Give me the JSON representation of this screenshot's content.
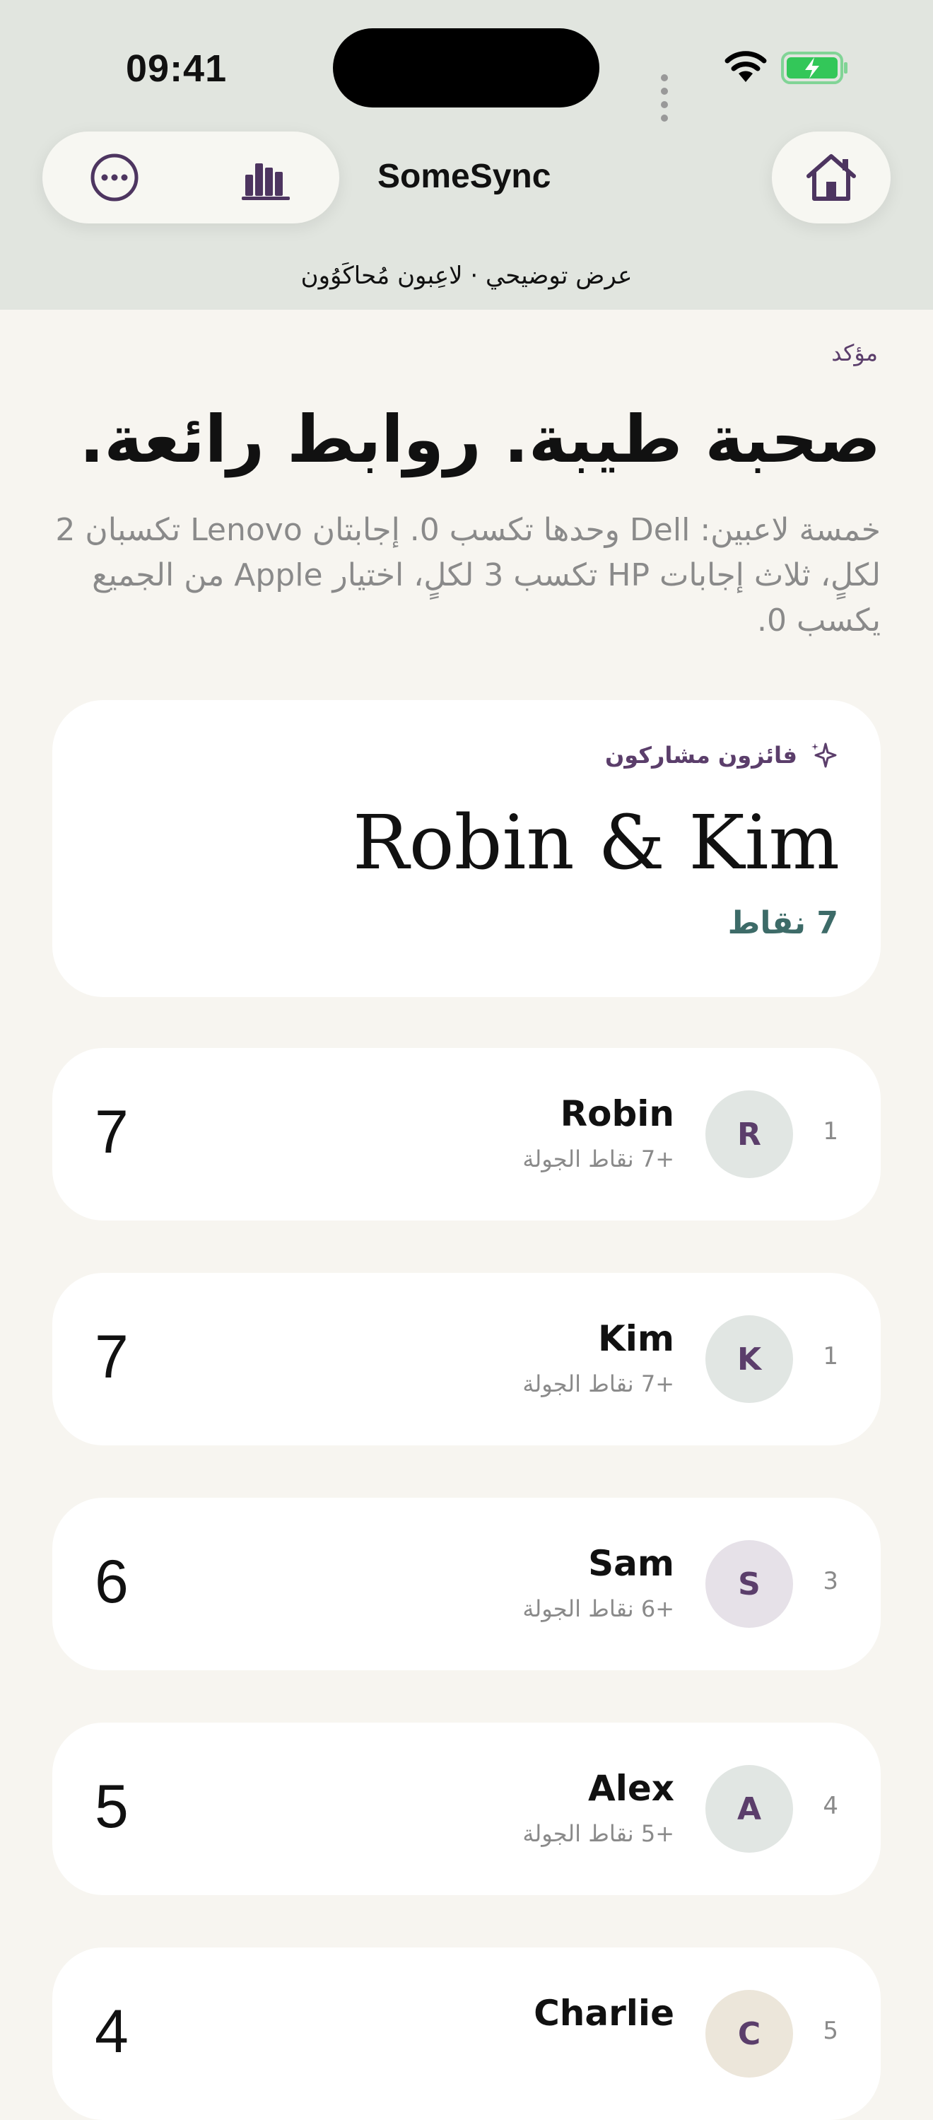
{
  "status_bar": {
    "time": "09:41"
  },
  "header": {
    "app_title": "SomeSync",
    "demo_label": "عرض توضيحي · لاعِبون مُحاكَوُون"
  },
  "round": {
    "status": "مؤكد",
    "headline": "صحبة طيبة. روابط رائعة.",
    "description": "خمسة لاعبين: Dell وحدها تكسب 0. إجابتان Lenovo تكسبان 2 لكلٍ، ثلاث إجابات HP تكسب 3 لكلٍ، اختيار Apple من الجميع يكسب 0."
  },
  "winner": {
    "label": "فائزون مشاركون",
    "names": "Robin & Kim",
    "points": "7 نقاط"
  },
  "leaderboard": [
    {
      "rank": "1",
      "initial": "R",
      "name": "Robin",
      "round_points": "+7 نقاط الجولة",
      "score": "7",
      "avatar_color": "#e1e6e3"
    },
    {
      "rank": "1",
      "initial": "K",
      "name": "Kim",
      "round_points": "+7 نقاط الجولة",
      "score": "7",
      "avatar_color": "#e1e6e3"
    },
    {
      "rank": "3",
      "initial": "S",
      "name": "Sam",
      "round_points": "+6 نقاط الجولة",
      "score": "6",
      "avatar_color": "#e6e1e8"
    },
    {
      "rank": "4",
      "initial": "A",
      "name": "Alex",
      "round_points": "+5 نقاط الجولة",
      "score": "5",
      "avatar_color": "#e1e6e3"
    },
    {
      "rank": "5",
      "initial": "C",
      "name": "Charlie",
      "round_points": "",
      "score": "4",
      "avatar_color": "#ece6da"
    }
  ],
  "colors": {
    "accent": "#5b3e6b",
    "teal": "#3d6b68",
    "header_bg": "#e1e5df",
    "page_bg": "#f7f5f0"
  }
}
